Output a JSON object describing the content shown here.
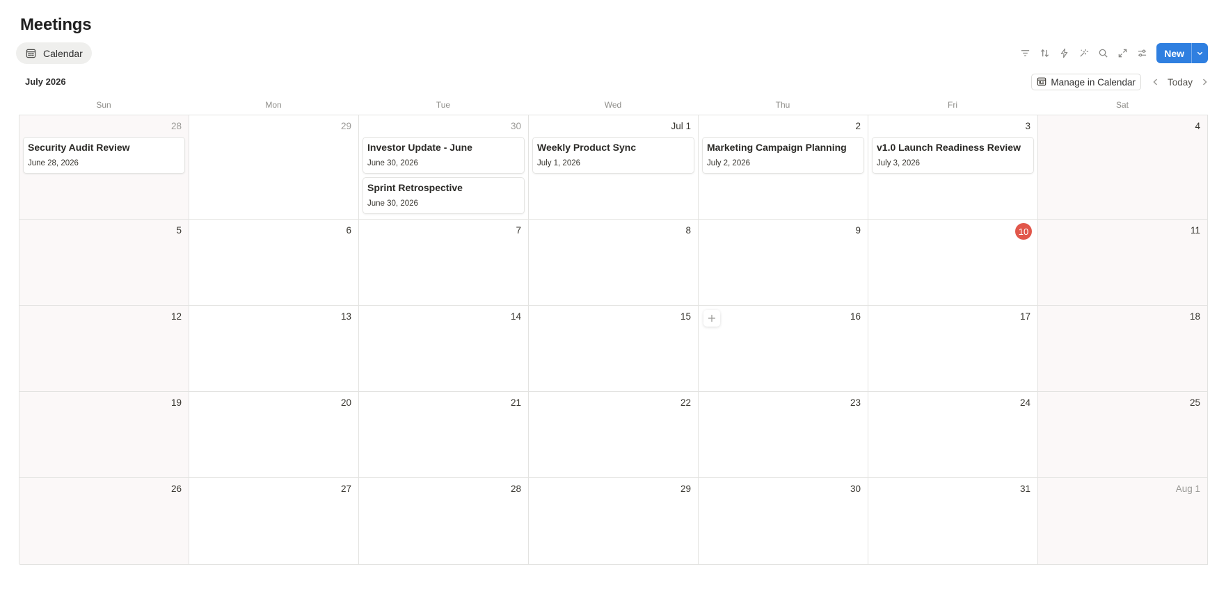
{
  "page": {
    "title": "Meetings"
  },
  "view_tab": {
    "label": "Calendar",
    "icon": "calendar-icon"
  },
  "toolbar": {
    "icons": [
      "filter-icon",
      "sort-icon",
      "automation-icon",
      "ai-sparkle-icon",
      "search-icon",
      "expand-icon",
      "settings-icon"
    ],
    "new_label": "New",
    "accent": "#2f7fe0"
  },
  "calendar": {
    "month_label": "July 2026",
    "manage_label": "Manage in Calendar",
    "today_label": "Today",
    "today_color": "#e1574b",
    "weekdays": [
      "Sun",
      "Mon",
      "Tue",
      "Wed",
      "Thu",
      "Fri",
      "Sat"
    ],
    "weeks": [
      [
        {
          "label": "28",
          "muted": true,
          "events": [
            {
              "title": "Security Audit Review",
              "date": "June 28, 2026"
            }
          ]
        },
        {
          "label": "29",
          "muted": true,
          "events": []
        },
        {
          "label": "30",
          "muted": true,
          "events": [
            {
              "title": "Investor Update - June",
              "date": "June 30, 2026"
            },
            {
              "title": "Sprint Retrospective",
              "date": "June 30, 2026"
            }
          ]
        },
        {
          "label": "Jul 1",
          "events": [
            {
              "title": "Weekly Product Sync",
              "date": "July 1, 2026"
            }
          ]
        },
        {
          "label": "2",
          "events": [
            {
              "title": "Marketing Campaign Planning",
              "date": "July 2, 2026"
            }
          ]
        },
        {
          "label": "3",
          "events": [
            {
              "title": "v1.0 Launch Readiness Review",
              "date": "July 3, 2026"
            }
          ]
        },
        {
          "label": "4",
          "events": []
        }
      ],
      [
        {
          "label": "5"
        },
        {
          "label": "6"
        },
        {
          "label": "7"
        },
        {
          "label": "8"
        },
        {
          "label": "9"
        },
        {
          "label": "10",
          "today": true
        },
        {
          "label": "11"
        }
      ],
      [
        {
          "label": "12"
        },
        {
          "label": "13"
        },
        {
          "label": "14"
        },
        {
          "label": "15"
        },
        {
          "label": "16",
          "hover_add": true
        },
        {
          "label": "17"
        },
        {
          "label": "18"
        }
      ],
      [
        {
          "label": "19"
        },
        {
          "label": "20"
        },
        {
          "label": "21"
        },
        {
          "label": "22"
        },
        {
          "label": "23"
        },
        {
          "label": "24"
        },
        {
          "label": "25"
        }
      ],
      [
        {
          "label": "26"
        },
        {
          "label": "27"
        },
        {
          "label": "28"
        },
        {
          "label": "29"
        },
        {
          "label": "30"
        },
        {
          "label": "31"
        },
        {
          "label": "Aug 1",
          "muted": true
        }
      ]
    ]
  }
}
